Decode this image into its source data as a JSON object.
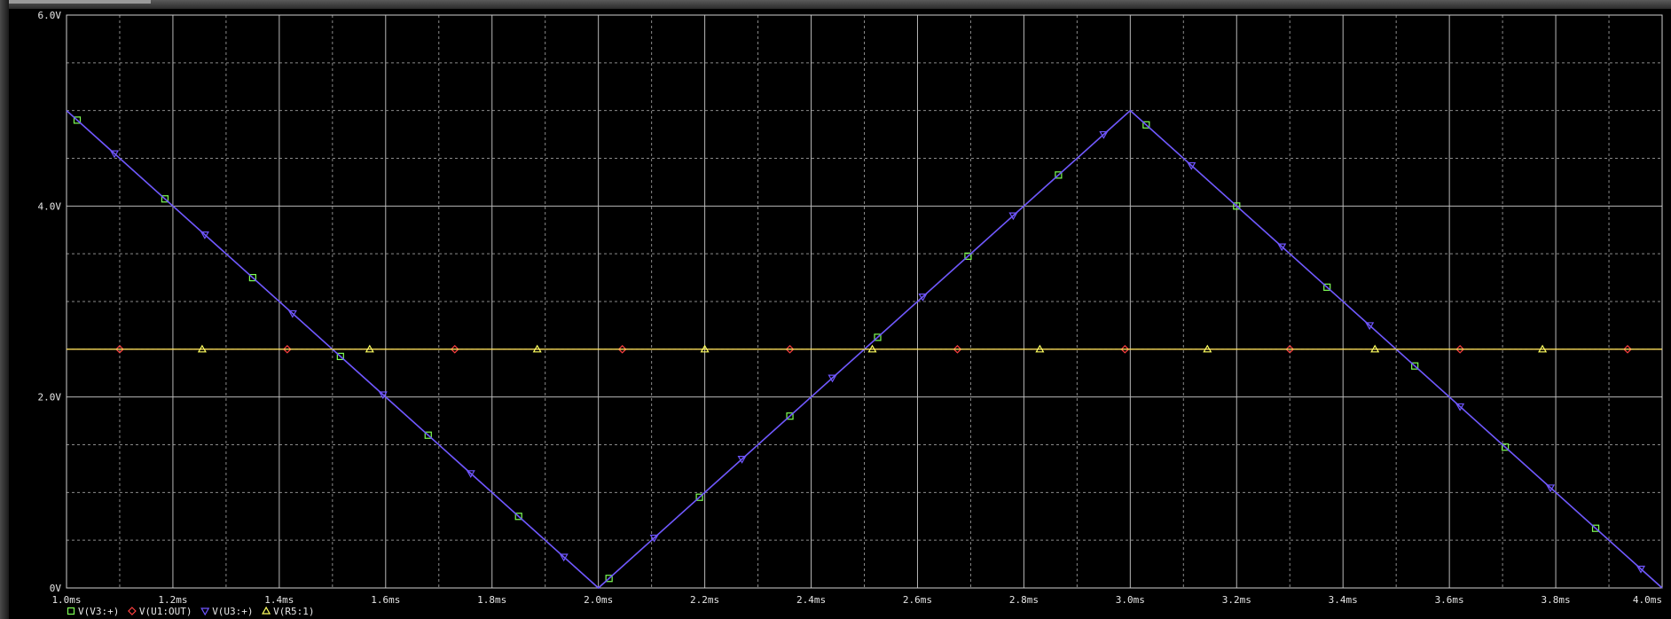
{
  "chart_data": {
    "type": "line",
    "title": "",
    "xlabel": "",
    "ylabel": "",
    "xlim": [
      1.0,
      4.0
    ],
    "ylim": [
      0,
      6
    ],
    "x_ticks": [
      {
        "v": 1.0,
        "label": "1.0ms"
      },
      {
        "v": 1.2,
        "label": "1.2ms"
      },
      {
        "v": 1.4,
        "label": "1.4ms"
      },
      {
        "v": 1.6,
        "label": "1.6ms"
      },
      {
        "v": 1.8,
        "label": "1.8ms"
      },
      {
        "v": 2.0,
        "label": "2.0ms"
      },
      {
        "v": 2.2,
        "label": "2.2ms"
      },
      {
        "v": 2.4,
        "label": "2.4ms"
      },
      {
        "v": 2.6,
        "label": "2.6ms"
      },
      {
        "v": 2.8,
        "label": "2.8ms"
      },
      {
        "v": 3.0,
        "label": "3.0ms"
      },
      {
        "v": 3.2,
        "label": "3.2ms"
      },
      {
        "v": 3.4,
        "label": "3.4ms"
      },
      {
        "v": 3.6,
        "label": "3.6ms"
      },
      {
        "v": 3.8,
        "label": "3.8ms"
      },
      {
        "v": 4.0,
        "label": "4.0ms"
      }
    ],
    "y_ticks": [
      {
        "v": 0,
        "label": "0V"
      },
      {
        "v": 2,
        "label": "2.0V"
      },
      {
        "v": 4,
        "label": "4.0V"
      },
      {
        "v": 6,
        "label": "6.0V"
      }
    ],
    "grid": true,
    "legend_position": "bottom-left",
    "background": "#000000",
    "series": [
      {
        "name": "V(V3:+)",
        "color": "#7fff55",
        "marker": "square",
        "x": [
          1.0,
          2.0,
          3.0,
          4.0
        ],
        "y": [
          5.0,
          0.0,
          5.0,
          0.0
        ],
        "marker_x": [
          1.02,
          1.185,
          1.35,
          1.515,
          1.68,
          1.85,
          2.02,
          2.19,
          2.36,
          2.525,
          2.695,
          2.865,
          3.03,
          3.2,
          3.37,
          3.535,
          3.705,
          3.875
        ]
      },
      {
        "name": "V(U1:OUT)",
        "color": "#ff4040",
        "marker": "diamond",
        "x": [
          1.0,
          4.0
        ],
        "y": [
          2.5,
          2.5
        ],
        "marker_x": [
          1.1,
          1.415,
          1.73,
          2.045,
          2.36,
          2.675,
          2.99,
          3.3,
          3.62,
          3.935
        ]
      },
      {
        "name": "V(U3:+)",
        "color": "#6f55ff",
        "marker": "triangle-down",
        "x": [
          1.0,
          2.0,
          3.0,
          4.0
        ],
        "y": [
          5.0,
          0.0,
          5.0,
          0.0
        ],
        "marker_x": [
          1.09,
          1.26,
          1.425,
          1.595,
          1.76,
          1.935,
          2.105,
          2.27,
          2.44,
          2.61,
          2.78,
          2.95,
          3.115,
          3.285,
          3.45,
          3.62,
          3.79,
          3.96
        ]
      },
      {
        "name": "V(R5:1)",
        "color": "#ffff60",
        "marker": "triangle-up",
        "x": [
          1.0,
          4.0
        ],
        "y": [
          2.5,
          2.5
        ],
        "marker_x": [
          1.255,
          1.57,
          1.885,
          2.2,
          2.515,
          2.83,
          3.145,
          3.46,
          3.775
        ]
      }
    ]
  }
}
